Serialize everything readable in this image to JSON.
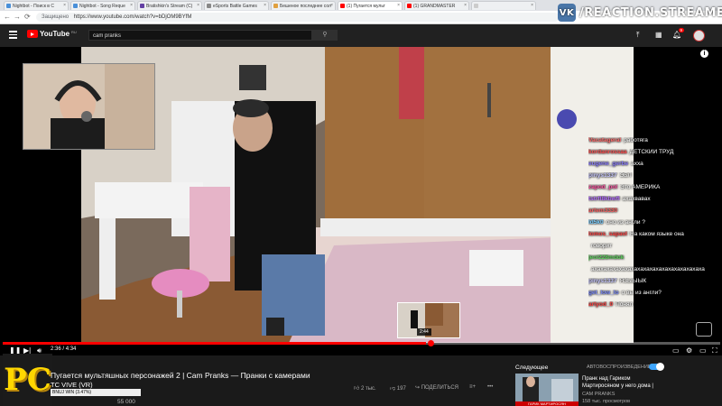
{
  "browser": {
    "tabs": [
      {
        "label": "Nightbot - Поиск в С",
        "favicon_color": "#4a90d9",
        "active": false
      },
      {
        "label": "Nightbot - Song Reque",
        "favicon_color": "#4a90d9",
        "active": false
      },
      {
        "label": "Bratishkin's Stream (C)",
        "favicon_color": "#6441a4",
        "active": false
      },
      {
        "label": "eSports Battle Games",
        "favicon_color": "#888888",
        "active": false
      },
      {
        "label": "Бешеное последнее сол",
        "favicon_color": "#e0a040",
        "active": false
      },
      {
        "label": "(1) Пугается мульт",
        "favicon_color": "#ff0000",
        "active": true
      },
      {
        "label": "(1) GRANDMASTER",
        "favicon_color": "#ff0000",
        "active": false
      },
      {
        "label": "",
        "favicon_color": "#cccccc",
        "active": false
      }
    ],
    "security_label": "Защищено",
    "url": "https://www.youtube.com/watch?v=bDjOM9BYfM"
  },
  "watermark": {
    "vk_badge": "VK",
    "text": "/REACTION.STREAMERS"
  },
  "youtube": {
    "logo_text": "YouTube",
    "logo_region": "RU",
    "search_value": "cam pranks",
    "notification_count": "9"
  },
  "chat": [
    {
      "user": "Vacatageral",
      "user_color": "#ff6b6b",
      "text": "работяга"
    },
    {
      "user": "kordanrossaa",
      "user_color": "#ff4f4f",
      "text": "ДЕТСКИЙ ТРУД"
    },
    {
      "user": "eugene_gerbe",
      "user_color": "#8a7cff",
      "text": "ахха"
    },
    {
      "user": "pinys1337",
      "user_color": "#c7c7ff",
      "text": "ЭБЛ"
    },
    {
      "user": "zapod_pol",
      "user_color": "#ff4fa0",
      "text": "Это АМЕРИКА"
    },
    {
      "user": "tstrfl8kbwfl",
      "user_color": "#b36bff",
      "text": "ахахвавах"
    },
    {
      "user": "artem3330",
      "user_color": "#ff6060",
      "text": ""
    },
    {
      "user": "Id5k0",
      "user_color": "#7cf",
      "text": "оно из англи ?"
    },
    {
      "user": "lomos_sapavl",
      "user_color": "#ff4040",
      "text": "На каком языке она"
    },
    {
      "user": "",
      "user_color": "#ffffff",
      "text": "говорит"
    },
    {
      "user": "jeoi228mdok",
      "user_color": "#5cd65c",
      "text": ""
    },
    {
      "user": "",
      "user_color": "#ffffff",
      "text": "ахахахахахахахахахахахахахахахахахаха"
    },
    {
      "user": "pinys1337",
      "user_color": "#c7c7ff",
      "text": "ЯЗЫЫЫК"
    },
    {
      "user": "get_low_lo",
      "user_color": "#7c8cff",
      "text": "о вы из англи?"
    },
    {
      "user": "artyod_0",
      "user_color": "#ff4040",
      "text": "Понял"
    }
  ],
  "player": {
    "time_current": "2:36",
    "time_total": "4:34",
    "progress_fraction": 0.59,
    "preview_time": "2:44"
  },
  "video": {
    "title": "Пугается мультяшных персонажей 2 | Cam Pranks — Пранки с камерами",
    "subtitle_line": "TC VIVE (VR)",
    "bar_label": "BNUJ WIN (3.47%)",
    "views": "55 000",
    "likes": "2 тыс.",
    "dislikes": "197",
    "share_label": "ПОДЕЛИТЬСЯ"
  },
  "sidebar": {
    "next_label": "Следующее",
    "autoplay_label": "АВТОВОСПРОИЗВЕДЕНИЕ",
    "autoplay_on": true,
    "next_video": {
      "title": "Пранк над Гариком Мартиросяном у него дома |",
      "channel": "CAM PRANKS",
      "views": "158 тыс. просмотров",
      "thumb_caption": "ГАРИК МАРТИРОСЯН"
    }
  },
  "pc_logo": "PC"
}
